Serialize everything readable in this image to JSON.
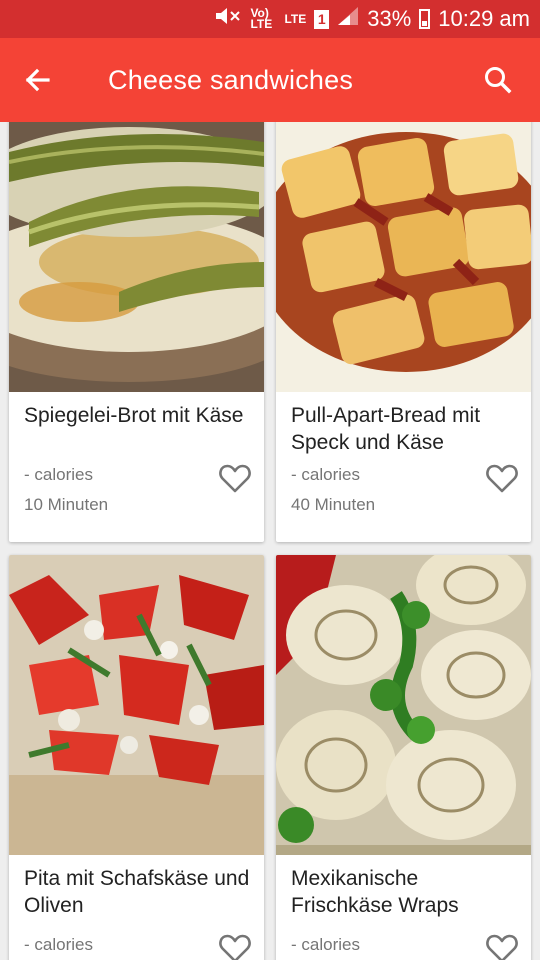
{
  "status_bar": {
    "volte": "Vo) LTE",
    "lte": "LTE",
    "sim": "1",
    "battery": "33%",
    "time": "10:29 am"
  },
  "app_bar": {
    "title": "Cheese sandwiches",
    "back_icon": "arrow-left-icon",
    "search_icon": "search-icon"
  },
  "colors": {
    "status_bar": "#d32f2f",
    "app_bar": "#f44336",
    "meta_text": "#757575"
  },
  "recipes": [
    {
      "title": "Spiegelei-Brot mit Käse",
      "calories": "- calories",
      "time": "10 Minuten"
    },
    {
      "title": "Pull-Apart-Bread mit Speck und Käse",
      "calories": "- calories",
      "time": "40 Minuten"
    },
    {
      "title": "Pita mit Schafskäse und Oliven",
      "calories": "- calories",
      "time": ""
    },
    {
      "title": "Mexikanische Frischkäse Wraps",
      "calories": "- calories",
      "time": ""
    }
  ]
}
